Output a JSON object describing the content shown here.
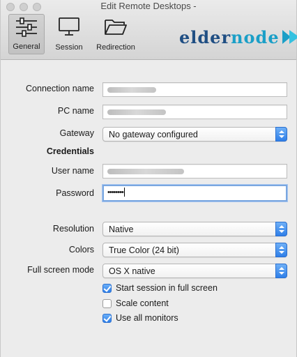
{
  "window": {
    "title": "Edit Remote Desktops -"
  },
  "toolbar": {
    "items": [
      {
        "label": "General",
        "icon": "sliders-icon",
        "selected": true
      },
      {
        "label": "Session",
        "icon": "monitor-icon",
        "selected": false
      },
      {
        "label": "Redirection",
        "icon": "folder-icon",
        "selected": false
      }
    ]
  },
  "brand": {
    "logo_part1": "elder",
    "logo_part2": "node"
  },
  "form": {
    "connection_name_label": "Connection name",
    "pc_name_label": "PC name",
    "gateway_label": "Gateway",
    "gateway_value": "No gateway configured",
    "credentials_title": "Credentials",
    "user_name_label": "User name",
    "password_label": "Password",
    "password_value": "••••••••",
    "resolution_label": "Resolution",
    "resolution_value": "Native",
    "colors_label": "Colors",
    "colors_value": "True Color (24 bit)",
    "fullscreen_label": "Full screen mode",
    "fullscreen_value": "OS X native",
    "checkboxes": [
      {
        "label": "Start session in full screen",
        "checked": true
      },
      {
        "label": "Scale content",
        "checked": false
      },
      {
        "label": "Use all monitors",
        "checked": true
      }
    ]
  },
  "colors": {
    "accent": "#2f7fe8",
    "logo_dark": "#1f4e83",
    "logo_light": "#1b9fc7"
  }
}
